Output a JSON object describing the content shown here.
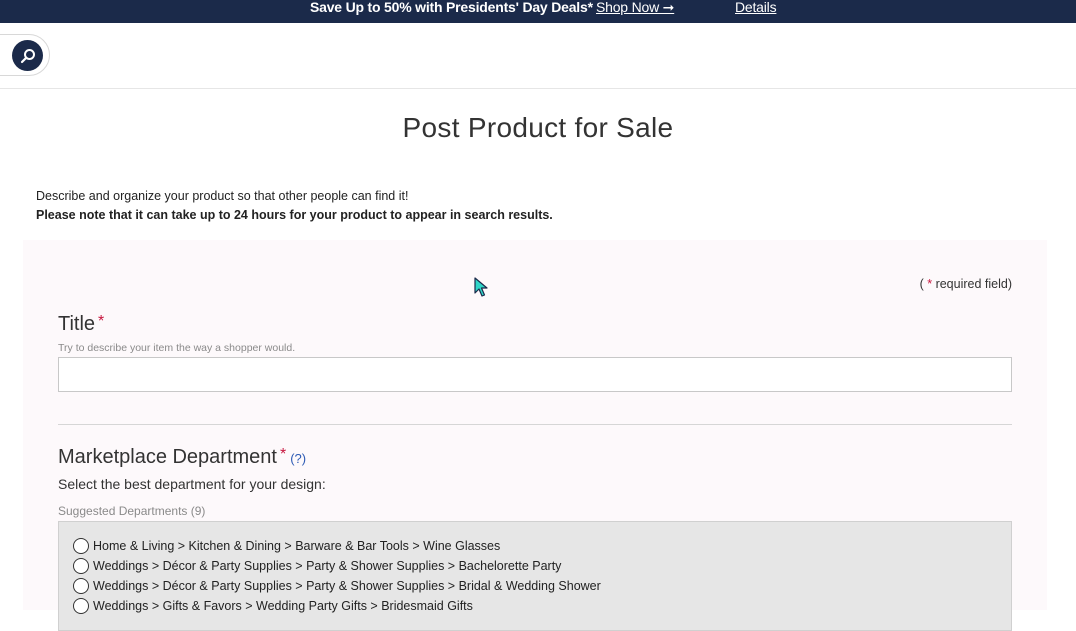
{
  "promo": {
    "text": "Save Up to 50% with Presidents' Day Deals*",
    "shop_label": "Shop Now ➞",
    "details_label": "Details"
  },
  "header": {
    "search_icon": "search-icon"
  },
  "page": {
    "title": "Post Product for Sale",
    "intro_line1": "Describe and organize your product so that other people can find it!",
    "intro_line2": "Please note that it can take up to 24 hours for your product to appear in search results."
  },
  "form": {
    "required_prefix": "( ",
    "required_star": "*",
    "required_suffix": " required field)",
    "title": {
      "label": "Title",
      "star": "*",
      "hint": "Try to describe your item the way a shopper would.",
      "value": ""
    },
    "department": {
      "label": "Marketplace Department",
      "star": "*",
      "help": "(?)",
      "subtitle": "Select the best department for your design:",
      "suggested_label": "Suggested Departments (9)",
      "items": [
        "Home & Living > Kitchen & Dining > Barware & Bar Tools > Wine Glasses",
        "Weddings > Décor & Party Supplies > Party & Shower Supplies > Bachelorette Party",
        "Weddings > Décor & Party Supplies > Party & Shower Supplies > Bridal & Wedding Shower",
        "Weddings > Gifts & Favors > Wedding Party Gifts > Bridesmaid Gifts"
      ]
    }
  },
  "colors": {
    "promo_bg": "#1b2a4a",
    "required_star": "#c7163e",
    "help_link": "#2d5bb5",
    "panel_bg": "#fdf9fb"
  }
}
